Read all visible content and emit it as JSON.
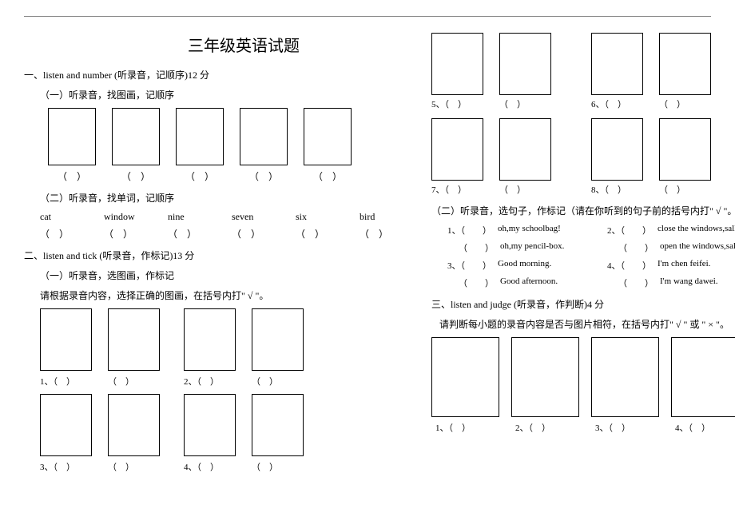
{
  "title": "三年级英语试题",
  "left": {
    "section1": {
      "head": "一、listen and number (听录音，记顺序)12 分",
      "sub1": "（一）听录音，找图画，记顺序",
      "paren": "（　）",
      "sub2": "（二）听录音，找单词，记顺序",
      "words": [
        "cat",
        "window",
        "nine",
        "seven",
        "six",
        "bird"
      ]
    },
    "section2": {
      "head": "二、listen and tick (听录音，作标记)13 分",
      "sub1": "（一）听录音，选图画，作标记",
      "instruction": "请根据录音内容，选择正确的图画，在括号内打\" √ \"。",
      "labels": {
        "l1a": "1、（　）",
        "l1b": "（　）",
        "l2a": "2、（　）",
        "l2b": "（　）",
        "l3a": "3、（　）",
        "l3b": "（　）",
        "l4a": "4、（　）",
        "l4b": "（　）"
      }
    }
  },
  "right": {
    "boxlabels": {
      "l5a": "5、（　）",
      "l5b": "（　）",
      "l6a": "6、（　）",
      "l6b": "（　）",
      "l7a": "7、（　）",
      "l7b": "（　）",
      "l8a": "8、（　）",
      "l8b": "（　）"
    },
    "sub2": "（二）听录音，选句子，作标记（请在你听到的句子前的括号内打\" √ \"。",
    "sentences": {
      "r1": {
        "a_num": "1、",
        "a_paren": "（　　）",
        "a_text": "oh,my schoolbag!",
        "b_num": "2、",
        "b_paren": "（　　）",
        "b_text": "close the windows,sally."
      },
      "r1b": {
        "a_paren": "（　　）",
        "a_text": "oh,my pencil-box.",
        "b_paren": "（　　）",
        "b_text": "open the windows,sally."
      },
      "r2": {
        "a_num": "3、",
        "a_paren": "（　　）",
        "a_text": "Good morning.",
        "b_num": "4、",
        "b_paren": "（　　）",
        "b_text": "I'm chen feifei."
      },
      "r2b": {
        "a_paren": "（　　）",
        "a_text": "Good afternoon.",
        "b_paren": "（　　）",
        "b_text": "I'm wang dawei."
      }
    },
    "section3": {
      "head": "三、listen and judge (听录音，作判断)4 分",
      "instruction": "请判断每小题的录音内容是否与图片相符，在括号内打\" √ \" 或 \" × \"。",
      "labels": {
        "l1": "1、（　）",
        "l2": "2、（　）",
        "l3": "3、（　）",
        "l4": "4、（　）"
      }
    }
  }
}
